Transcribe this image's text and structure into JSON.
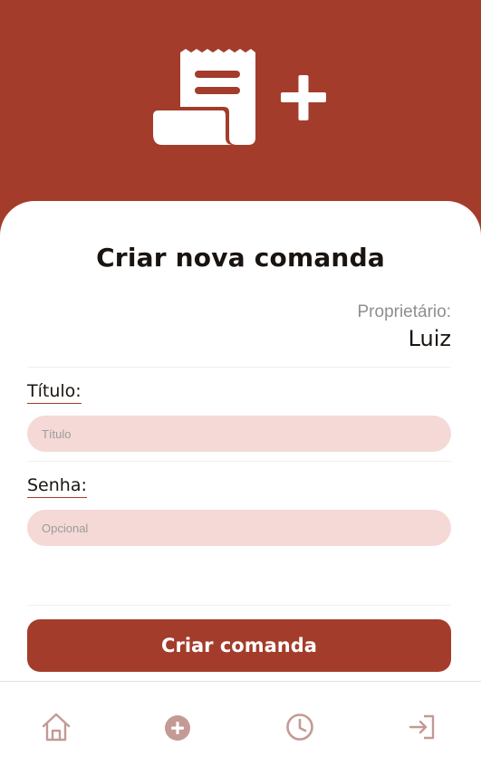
{
  "colors": {
    "brand": "#a43c2b",
    "input_background": "#f5d9d6",
    "nav_icon": "#c49a95",
    "muted_text": "#8e8e8e"
  },
  "header": {
    "icon": "receipt-add-icon"
  },
  "page": {
    "title": "Criar nova comanda"
  },
  "owner": {
    "label": "Proprietário:",
    "name": "Luiz"
  },
  "form": {
    "title_field": {
      "label": "Título:",
      "placeholder": "Título",
      "value": ""
    },
    "password_field": {
      "label": "Senha:",
      "placeholder": "Opcional",
      "value": ""
    },
    "submit_label": "Criar comanda"
  },
  "bottom_nav": {
    "items": [
      {
        "icon": "home-icon"
      },
      {
        "icon": "add-circle-icon",
        "active": true
      },
      {
        "icon": "clock-icon"
      },
      {
        "icon": "logout-icon"
      }
    ]
  }
}
